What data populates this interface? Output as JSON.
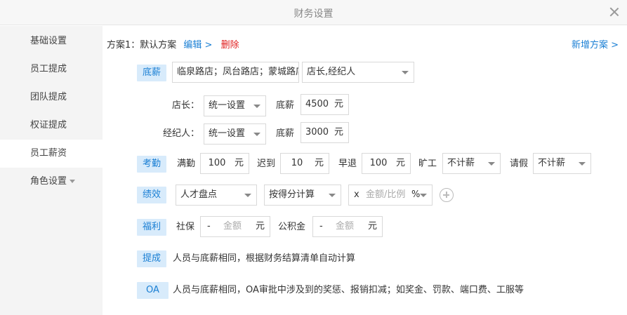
{
  "window": {
    "title": "财务设置"
  },
  "sidebar": {
    "items": [
      {
        "label": "基础设置"
      },
      {
        "label": "员工提成"
      },
      {
        "label": "团队提成"
      },
      {
        "label": "权证提成"
      },
      {
        "label": "员工薪资",
        "active": true
      },
      {
        "label": "角色设置"
      }
    ]
  },
  "plan": {
    "name": "方案1：默认方案",
    "edit": "编辑 >",
    "delete": "删除",
    "add": "新增方案 >"
  },
  "base_salary": {
    "tag": "底薪",
    "stores_value": "临泉路店；凤台路店；蒙城路店",
    "roles_value": "店长,经纪人",
    "rows": [
      {
        "role_label": "店长：",
        "mode": "统一设置",
        "amount_label": "底薪",
        "amount": "4500",
        "unit": "元"
      },
      {
        "role_label": "经纪人：",
        "mode": "统一设置",
        "amount_label": "底薪",
        "amount": "3000",
        "unit": "元"
      }
    ]
  },
  "attendance": {
    "tag": "考勤",
    "full_label": "满勤",
    "full_value": "100",
    "full_unit": "元",
    "late_label": "迟到",
    "late_value": "10",
    "late_unit": "元",
    "early_label": "早退",
    "early_value": "100",
    "early_unit": "元",
    "absent_label": "旷工",
    "absent_value": "不计薪",
    "leave_label": "请假",
    "leave_value": "不计薪"
  },
  "performance": {
    "tag": "绩效",
    "type_value": "人才盘点",
    "calc_value": "按得分计算",
    "multiplier": "x",
    "amount_placeholder": "金额/比例",
    "unit": "%"
  },
  "welfare": {
    "tag": "福利",
    "social_label": "社保",
    "social_dash": "-",
    "social_placeholder": "金额",
    "social_unit": "元",
    "fund_label": "公积金",
    "fund_dash": "-",
    "fund_placeholder": "金额",
    "fund_unit": "元"
  },
  "commission": {
    "tag": "提成",
    "text": "人员与底薪相同，根据财务结算清单自动计算"
  },
  "oa": {
    "tag": "OA",
    "text": "人员与底薪相同，OA审批中涉及到的奖惩、报销扣减；如奖金、罚款、端口费、工服等"
  },
  "colors": {
    "accent": "#1a7fd4",
    "danger": "#e02020",
    "tag_bg": "#d8ebfb",
    "sidebar_bg": "#f4f4f4"
  }
}
